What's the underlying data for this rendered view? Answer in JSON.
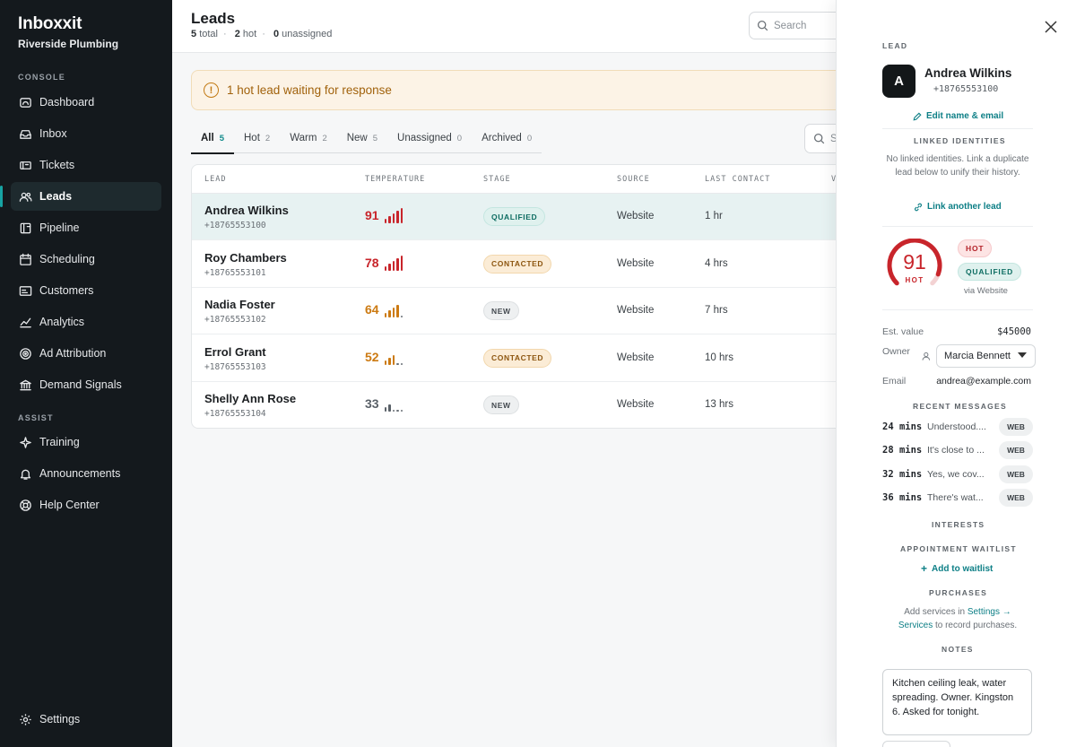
{
  "brand": {
    "name": "Inboxxit",
    "org": "Riverside Plumbing"
  },
  "sidebar": {
    "console_label": "CONSOLE",
    "assist_label": "ASSIST",
    "items": [
      {
        "label": "Dashboard",
        "icon": "dashboard-icon"
      },
      {
        "label": "Inbox",
        "icon": "inbox-icon"
      },
      {
        "label": "Tickets",
        "icon": "ticket-icon"
      },
      {
        "label": "Leads",
        "icon": "users-icon",
        "active": true
      },
      {
        "label": "Pipeline",
        "icon": "pipeline-icon"
      },
      {
        "label": "Scheduling",
        "icon": "calendar-icon"
      },
      {
        "label": "Customers",
        "icon": "id-card-icon"
      },
      {
        "label": "Analytics",
        "icon": "chart-line-icon"
      },
      {
        "label": "Ad Attribution",
        "icon": "target-icon"
      },
      {
        "label": "Demand Signals",
        "icon": "bank-icon"
      }
    ],
    "assist_items": [
      {
        "label": "Training",
        "icon": "sparkle-icon"
      },
      {
        "label": "Announcements",
        "icon": "bell-icon"
      },
      {
        "label": "Help Center",
        "icon": "lifebuoy-icon"
      }
    ],
    "settings_label": "Settings"
  },
  "header": {
    "title": "Leads",
    "stats": {
      "total": "5",
      "total_label": "total",
      "hot": "2",
      "hot_label": "hot",
      "unassigned": "0",
      "unassigned_label": "unassigned"
    },
    "search_placeholder": "Search"
  },
  "alert": {
    "text": "1 hot lead waiting for response"
  },
  "tabs": [
    {
      "label": "All",
      "count": "5",
      "active": true
    },
    {
      "label": "Hot",
      "count": "2"
    },
    {
      "label": "Warm",
      "count": "2"
    },
    {
      "label": "New",
      "count": "5"
    },
    {
      "label": "Unassigned",
      "count": "0"
    },
    {
      "label": "Archived",
      "count": "0"
    }
  ],
  "table": {
    "columns": [
      "LEAD",
      "TEMPERATURE",
      "STAGE",
      "SOURCE",
      "LAST CONTACT",
      "V"
    ],
    "rows": [
      {
        "name": "Andrea Wilkins",
        "phone": "+18765553100",
        "temp": "91",
        "level": 5,
        "stage": "QUALIFIED",
        "stage_kind": "qualified",
        "source": "Website",
        "last": "1 hr",
        "selected": true
      },
      {
        "name": "Roy Chambers",
        "phone": "+18765553101",
        "temp": "78",
        "level": 5,
        "stage": "CONTACTED",
        "stage_kind": "contacted",
        "source": "Website",
        "last": "4 hrs"
      },
      {
        "name": "Nadia Foster",
        "phone": "+18765553102",
        "temp": "64",
        "level": 4,
        "stage": "NEW",
        "stage_kind": "new",
        "source": "Website",
        "last": "7 hrs"
      },
      {
        "name": "Errol Grant",
        "phone": "+18765553103",
        "temp": "52",
        "level": 3,
        "stage": "CONTACTED",
        "stage_kind": "contacted",
        "source": "Website",
        "last": "10 hrs"
      },
      {
        "name": "Shelly Ann Rose",
        "phone": "+18765553104",
        "temp": "33",
        "level": 2,
        "stage": "NEW",
        "stage_kind": "new",
        "source": "Website",
        "last": "13 hrs"
      }
    ]
  },
  "colors": {
    "hot": "#c8252b",
    "warm": "#cc7a12",
    "cold": "#5a6168",
    "accent": "#0d7f86",
    "sidebar_bg": "#14191d"
  },
  "panel": {
    "section_label": "LEAD",
    "avatar_letter": "A",
    "name": "Andrea Wilkins",
    "phone": "+18765553100",
    "edit_link": "Edit name & email",
    "linked_label": "LINKED IDENTITIES",
    "linked_text": "No linked identities. Link a duplicate lead below to unify their history.",
    "link_another": "Link another lead",
    "score": "91",
    "score_max": 100,
    "score_label": "HOT",
    "chip_hot": "HOT",
    "chip_stage": "QUALIFIED",
    "via": "via Website",
    "est_label": "Est. value",
    "est_value": "$45000",
    "owner_label": "Owner",
    "owner_value": "Marcia Bennett",
    "email_label": "Email",
    "email_value": "andrea@example.com",
    "recent_label": "RECENT MESSAGES",
    "messages": [
      {
        "time": "24 mins",
        "text": "Understood....",
        "channel": "WEB"
      },
      {
        "time": "28 mins",
        "text": "It's close to ...",
        "channel": "WEB"
      },
      {
        "time": "32 mins",
        "text": "Yes, we cov...",
        "channel": "WEB"
      },
      {
        "time": "36 mins",
        "text": "There's wat...",
        "channel": "WEB"
      }
    ],
    "interests_label": "INTERESTS",
    "waitlist_label": "APPOINTMENT WAITLIST",
    "add_waitlist": "Add to waitlist",
    "purchases_label": "PURCHASES",
    "purchases_pre": "Add services in",
    "purchases_link": "Settings →",
    "purchases_link2": "Services",
    "purchases_post": "to record purchases.",
    "notes_label": "NOTES",
    "notes_text": "Kitchen ceiling leak, water spreading. Owner. Kingston 6. Asked for tonight."
  }
}
